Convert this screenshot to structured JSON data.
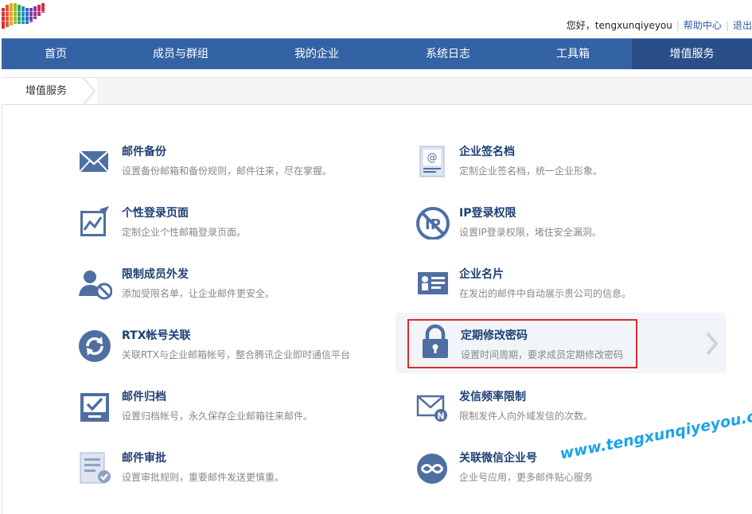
{
  "header": {
    "greeting": "您好，tengxunqiyeyou",
    "help_label": "帮助中心",
    "logout_label": "退出"
  },
  "nav": {
    "items": [
      {
        "label": "首页"
      },
      {
        "label": "成员与群组"
      },
      {
        "label": "我的企业"
      },
      {
        "label": "系统日志"
      },
      {
        "label": "工具箱"
      },
      {
        "label": "增值服务"
      }
    ],
    "active_index": 5
  },
  "breadcrumb": {
    "current": "增值服务"
  },
  "services": [
    {
      "title": "邮件备份",
      "desc": "设置备份邮箱和备份规则，邮件往来，尽在掌握。",
      "icon": "mail-icon"
    },
    {
      "title": "企业签名档",
      "desc": "定制企业签名档，统一企业形象。",
      "icon": "signature-icon"
    },
    {
      "title": "个性登录页面",
      "desc": "定制企业个性邮箱登录页面。",
      "icon": "login-page-icon"
    },
    {
      "title": "IP登录权限",
      "desc": "设置IP登录权限，堵住安全漏洞。",
      "icon": "ip-restrict-icon"
    },
    {
      "title": "限制成员外发",
      "desc": "添加受限名单，让企业邮件更安全。",
      "icon": "user-block-icon"
    },
    {
      "title": "企业名片",
      "desc": "在发出的邮件中自动展示贵公司的信息。",
      "icon": "business-card-icon"
    },
    {
      "title": "RTX帐号关联",
      "desc": "关联RTX与企业邮箱帐号，整合腾讯企业即时通信平台",
      "icon": "sync-icon"
    },
    {
      "title": "定期修改密码",
      "desc": "设置时间周期，要求成员定期修改密码",
      "icon": "lock-icon"
    },
    {
      "title": "邮件归档",
      "desc": "设置归档帐号，永久保存企业邮箱往来邮件。",
      "icon": "archive-icon"
    },
    {
      "title": "发信频率限制",
      "desc": "限制发件人向外域发信的次数。",
      "icon": "mail-limit-icon"
    },
    {
      "title": "邮件审批",
      "desc": "设置审批规则，重要邮件发送更慎重。",
      "icon": "approval-icon"
    },
    {
      "title": "关联微信企业号",
      "desc": "企业号应用，更多邮件贴心服务",
      "icon": "wechat-link-icon"
    }
  ],
  "watermark": "www.tengxunqiyeyou.com",
  "colors": {
    "nav_bg": "#3463a5",
    "nav_active_bg": "#2a4f88",
    "title_color": "#1e3f74",
    "icon_color": "#4f6fa3",
    "highlight": "#d92b2b",
    "watermark": "#1aa4e8"
  }
}
